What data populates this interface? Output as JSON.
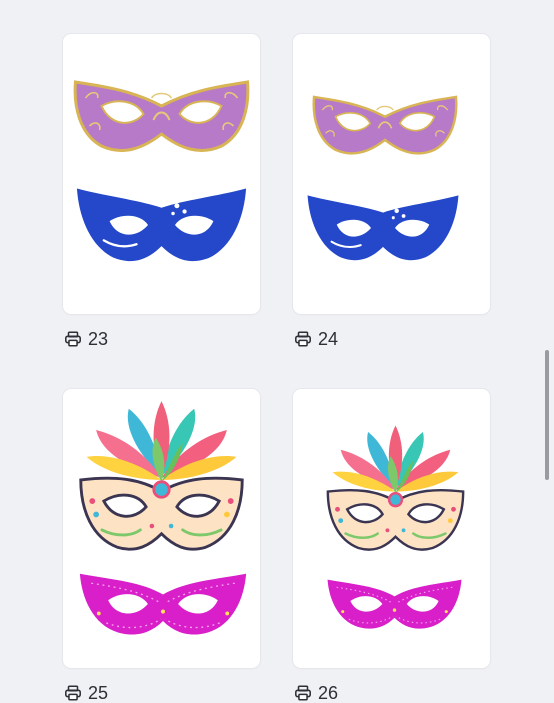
{
  "grid": {
    "items": [
      {
        "print_count": "23",
        "image": "purple-gold-masquerade-and-blue-mask"
      },
      {
        "print_count": "24",
        "image": "purple-gold-masquerade-and-blue-mask-small"
      },
      {
        "print_count": "25",
        "image": "feathered-carnival-mask-and-magenta-mask"
      },
      {
        "print_count": "26",
        "image": "feathered-carnival-mask-and-magenta-mask-small"
      }
    ],
    "print_icon": "printer-icon"
  },
  "colors": {
    "background": "#f0f1f4",
    "card": "#ffffff",
    "blue_mask": "#2347c9",
    "purple_mask": "#b576c8",
    "gold_trim": "#d9b455",
    "magenta_mask": "#d81fc9"
  }
}
